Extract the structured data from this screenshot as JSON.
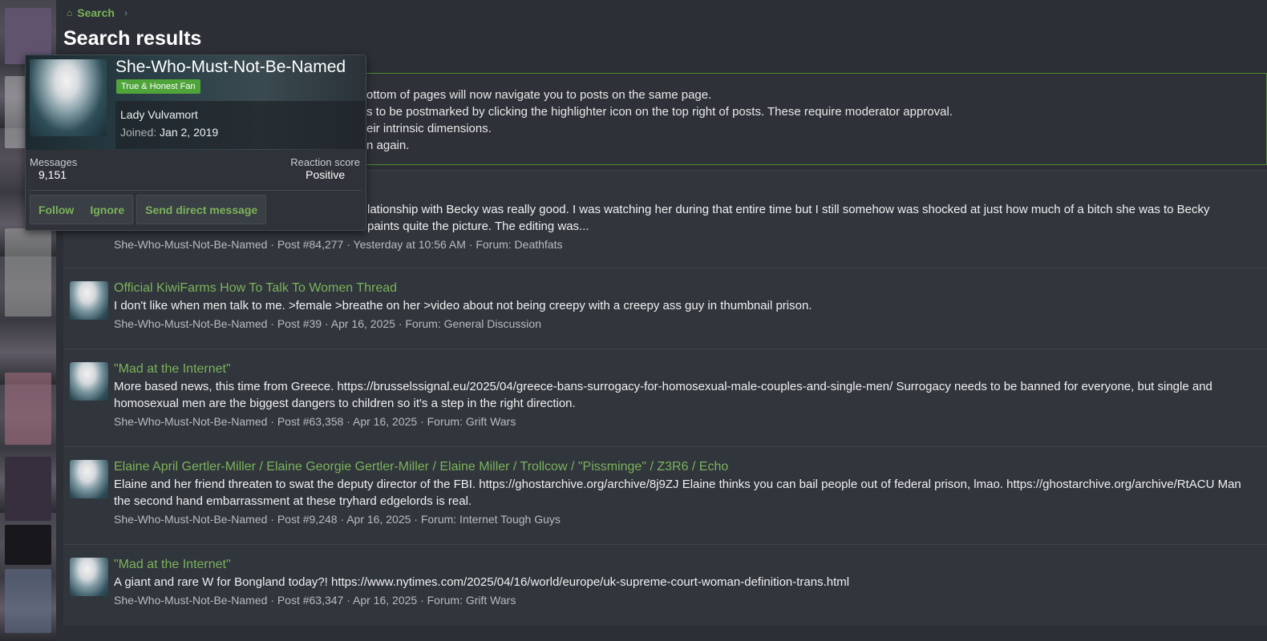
{
  "breadcrumb": {
    "label": "Search"
  },
  "page_title": "Search results",
  "notice": {
    "lines": [
      "ottom of pages will now navigate you to posts on the same page.",
      "s to be postmarked by clicking the highlighter icon on the top right of posts. These require moderator approval.",
      "eir intrinsic dimensions.",
      "n again."
    ]
  },
  "results": [
    {
      "snippet": "lationship with Becky was really good. I was watching her during that entire time but I still somehow was shocked at just how much of a bitch she was to Becky",
      "snippet_line2": "paints quite the picture. The editing was...",
      "meta": "She-Who-Must-Not-Be-Named · Post #84,277 · Yesterday at 10:56 AM · Forum: Deathfats"
    },
    {
      "title": "Official KiwiFarms How To Talk To Women Thread",
      "snippet": "I don't like when men talk to me. >female >breathe on her >video about not being creepy with a creepy ass guy in thumbnail prison.",
      "meta": "She-Who-Must-Not-Be-Named · Post #39 · Apr 16, 2025 · Forum: General Discussion"
    },
    {
      "title": "\"Mad at the Internet\"",
      "snippet": "More based news, this time from Greece. https://brusselssignal.eu/2025/04/greece-bans-surrogacy-for-homosexual-male-couples-and-single-men/ Surrogacy needs to be banned for everyone, but single and homosexual men are the biggest dangers to children so it's a step in the right direction.",
      "meta": "She-Who-Must-Not-Be-Named · Post #63,358 · Apr 16, 2025 · Forum: Grift Wars"
    },
    {
      "title": "Elaine April Gertler-Miller / Elaine Georgie Gertler-Miller / Elaine Miller / Trollcow / \"Pissminge\" / Z3R6 / Echo",
      "snippet": "Elaine and her friend threaten to swat the deputy director of the FBI. https://ghostarchive.org/archive/8j9ZJ Elaine thinks you can bail people out of federal prison, lmao. https://ghostarchive.org/archive/RtACU Man the second hand embarrassment at these tryhard edgelords is real.",
      "meta": "She-Who-Must-Not-Be-Named · Post #9,248 · Apr 16, 2025 · Forum: Internet Tough Guys"
    },
    {
      "title": "\"Mad at the Internet\"",
      "snippet": "A giant and rare W for Bongland today?! https://www.nytimes.com/2025/04/16/world/europe/uk-supreme-court-woman-definition-trans.html",
      "meta": "She-Who-Must-Not-Be-Named · Post #63,347 · Apr 16, 2025 · Forum: Grift Wars"
    }
  ],
  "tooltip": {
    "username": "She-Who-Must-Not-Be-Named",
    "badge": "True & Honest Fan",
    "custom_title": "Lady Vulvamort",
    "joined_label": "Joined:",
    "joined_value": "Jan 2, 2019",
    "messages_label": "Messages",
    "messages_value": "9,151",
    "reaction_label": "Reaction score",
    "reaction_value": "Positive",
    "follow": "Follow",
    "ignore": "Ignore",
    "dm": "Send direct message"
  },
  "colors": {
    "accent_green": "#7bb35a",
    "badge_green": "#4fa43a",
    "background": "#2c2f35"
  }
}
